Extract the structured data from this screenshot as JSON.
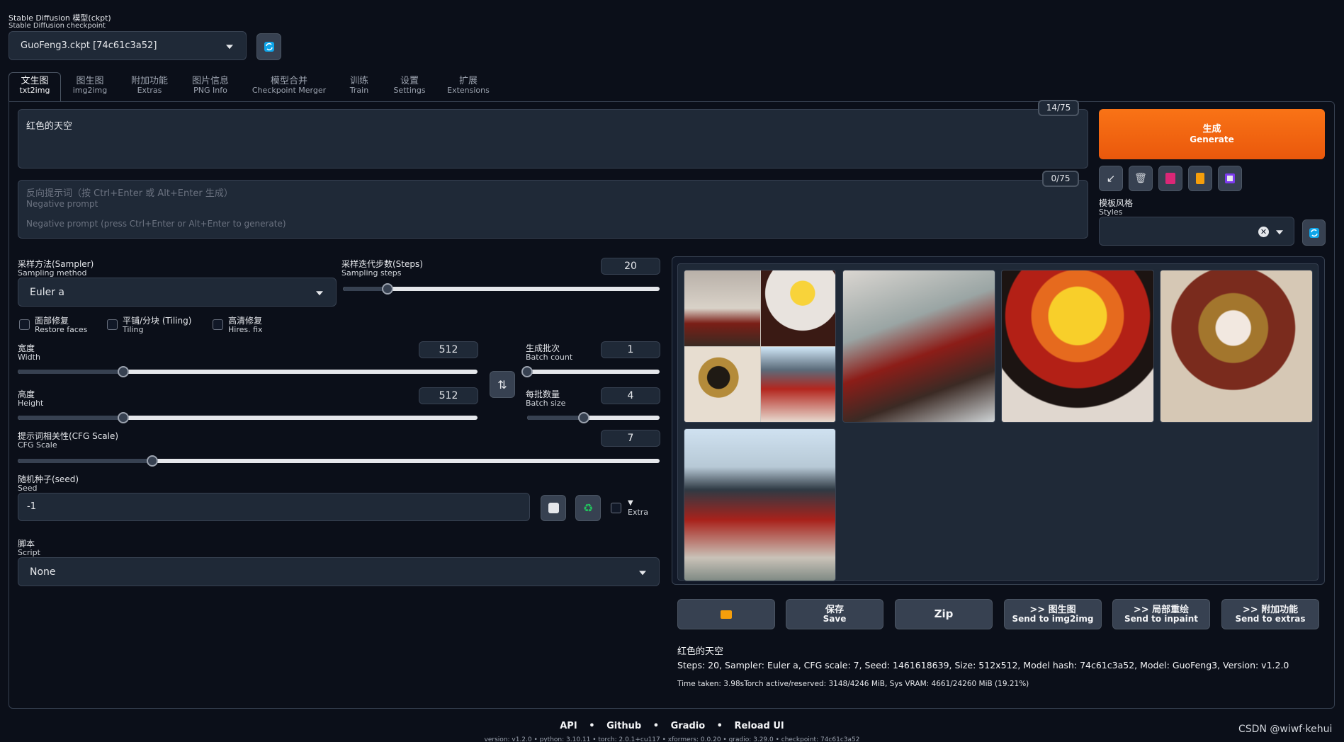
{
  "checkpoint": {
    "label_cn": "Stable Diffusion 模型(ckpt)",
    "label_en": "Stable Diffusion checkpoint",
    "value": "GuoFeng3.ckpt [74c61c3a52]"
  },
  "tabs": [
    {
      "cn": "文生图",
      "en": "txt2img"
    },
    {
      "cn": "图生图",
      "en": "img2img"
    },
    {
      "cn": "附加功能",
      "en": "Extras"
    },
    {
      "cn": "图片信息",
      "en": "PNG Info"
    },
    {
      "cn": "模型合并",
      "en": "Checkpoint Merger"
    },
    {
      "cn": "训练",
      "en": "Train"
    },
    {
      "cn": "设置",
      "en": "Settings"
    },
    {
      "cn": "扩展",
      "en": "Extensions"
    }
  ],
  "prompt": {
    "value": "红色的天空",
    "token_count": "14/75"
  },
  "negative_prompt": {
    "placeholder_cn": "反向提示词（按 Ctrl+Enter 或 Alt+Enter 生成）",
    "placeholder_en1": "Negative prompt",
    "placeholder_en2": "Negative prompt (press Ctrl+Enter or Alt+Enter to generate)",
    "token_count": "0/75"
  },
  "generate": {
    "cn": "生成",
    "en": "Generate",
    "color": "#f97316"
  },
  "styles": {
    "label_cn": "模板风格",
    "label_en": "Styles"
  },
  "sampler": {
    "label_cn": "采样方法(Sampler)",
    "label_en": "Sampling method",
    "value": "Euler a"
  },
  "steps": {
    "label_cn": "采样迭代步数(Steps)",
    "label_en": "Sampling steps",
    "value": "20",
    "fraction": 0.14
  },
  "checks": {
    "restore_faces": {
      "cn": "面部修复",
      "en": "Restore faces"
    },
    "tiling": {
      "cn": "平铺/分块 (Tiling)",
      "en": "Tiling"
    },
    "hires": {
      "cn": "高清修复",
      "en": "Hires. fix"
    }
  },
  "width": {
    "label_cn": "宽度",
    "label_en": "Width",
    "value": "512",
    "fraction": 0.23
  },
  "height": {
    "label_cn": "高度",
    "label_en": "Height",
    "value": "512",
    "fraction": 0.23
  },
  "batch_count": {
    "label_cn": "生成批次",
    "label_en": "Batch count",
    "value": "1",
    "fraction": 0.0
  },
  "batch_size": {
    "label_cn": "每批数量",
    "label_en": "Batch size",
    "value": "4",
    "fraction": 0.43
  },
  "cfg": {
    "label_cn": "提示词相关性(CFG Scale)",
    "label_en": "CFG Scale",
    "value": "7",
    "fraction": 0.21
  },
  "seed": {
    "label_cn": "随机种子(seed)",
    "label_en": "Seed",
    "value": "-1",
    "extra": "Extra"
  },
  "script": {
    "label_cn": "脚本",
    "label_en": "Script",
    "value": "None"
  },
  "output_buttons": [
    {
      "cn": "",
      "en": "",
      "icon": "folder-icon"
    },
    {
      "cn": "保存",
      "en": "Save"
    },
    {
      "cn": "Zip",
      "en": ""
    },
    {
      "cn": ">> 图生图",
      "en": "Send to img2img"
    },
    {
      "cn": ">> 局部重绘",
      "en": "Send to inpaint"
    },
    {
      "cn": ">> 附加功能",
      "en": "Send to extras"
    }
  ],
  "info": {
    "prompt": "红色的天空",
    "params": "Steps: 20, Sampler: Euler a, CFG scale: 7, Seed: 1461618639, Size: 512x512, Model hash: 74c61c3a52, Model: GuoFeng3, Version: v1.2.0",
    "time": "Time taken: 3.98sTorch active/reserved: 3148/4246 MiB, Sys VRAM: 4661/24260 MiB (19.21%)"
  },
  "footer": {
    "links": [
      "API",
      "Github",
      "Gradio",
      "Reload UI"
    ],
    "version": "version: v1.2.0  •  python: 3.10.11  •  torch: 2.0.1+cu117  •  xformers: 0.0.20  •  gradio: 3.29.0  •  checkpoint: 74c61c3a52"
  },
  "watermark": "CSDN @wiwf·kehui"
}
